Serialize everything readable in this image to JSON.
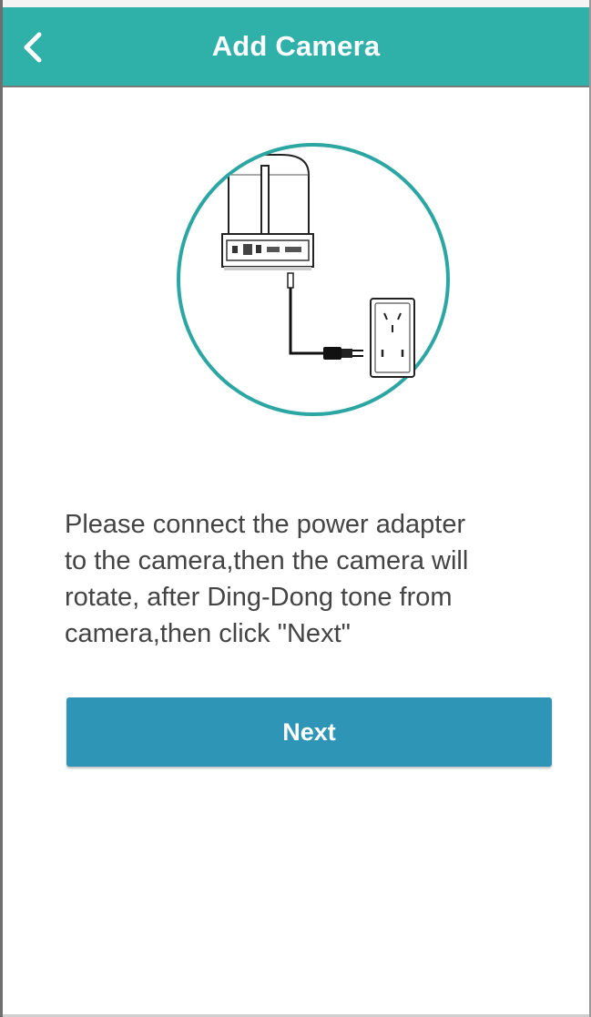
{
  "colors": {
    "header_bg": "#2fb0a8",
    "button_bg": "#2f95b6",
    "circle_stroke": "#2ba6a2",
    "text": "#444444"
  },
  "header": {
    "back_icon": "chevron-left-icon",
    "title": "Add Camera"
  },
  "illustration": {
    "description_icon": "camera-plug-illustration"
  },
  "instruction": {
    "text": "Please connect the power adapter\nto the camera,then the camera will\nrotate, after  Ding-Dong tone from\ncamera,then click  \"Next\""
  },
  "actions": {
    "next_label": "Next"
  }
}
